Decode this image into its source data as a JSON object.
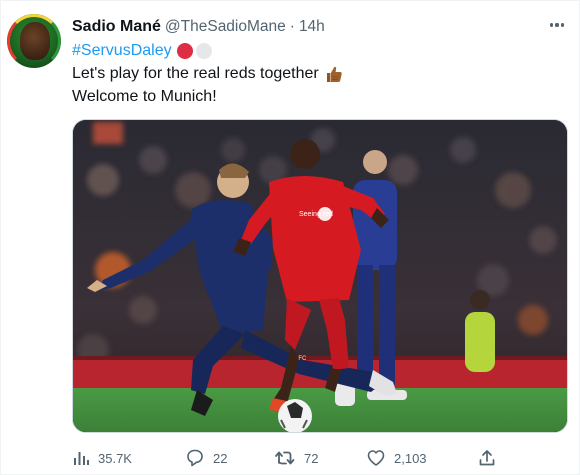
{
  "tweet": {
    "author_name": "Sadio Mané",
    "handle": "@TheSadioMane",
    "separator": "·",
    "time": "14h",
    "hashtag": "#ServusDaley",
    "line2": "Let's play for the real reds together",
    "line3": "Welcome to Munich!",
    "emoji": [
      "red-circle",
      "white-circle",
      "thumbs-up"
    ]
  },
  "image": {
    "jersey_sponsor": "Seeing red",
    "kit_badge": "LFC"
  },
  "actions": {
    "views": "35.7K",
    "replies": "22",
    "retweets": "72",
    "likes": "2,103"
  },
  "colors": {
    "hashtag": "#1d9bf0",
    "secondary_text": "#536471",
    "liverpool_red": "#d51a22",
    "united_navy": "#1c2f6b",
    "pitch_green": "#3f8a3b"
  },
  "icons": [
    "more-icon",
    "views-icon",
    "reply-icon",
    "retweet-icon",
    "like-icon",
    "share-icon"
  ]
}
